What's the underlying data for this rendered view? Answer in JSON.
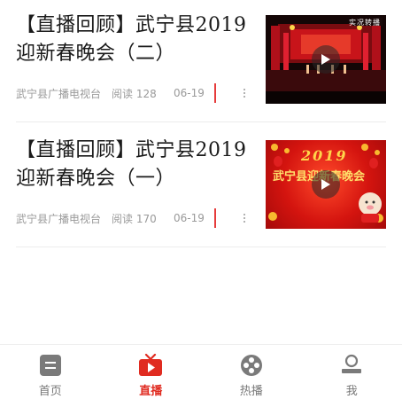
{
  "articles": [
    {
      "title": "【直播回顾】武宁县2019迎新春晚会（二）",
      "source": "武宁县广播电视台",
      "reads": "阅读 128",
      "date": "06-19",
      "thumb_caption": "实况转播"
    },
    {
      "title": "【直播回顾】武宁县2019迎新春晚会（一）",
      "source": "武宁县广播电视台",
      "reads": "阅读 170",
      "date": "06-19",
      "thumb_caption": "2019",
      "thumb_subcaption": "武宁县迎新春晚会"
    }
  ],
  "tabbar": {
    "items": [
      {
        "label": "首页",
        "icon": "home-icon"
      },
      {
        "label": "直播",
        "icon": "tv-icon"
      },
      {
        "label": "热播",
        "icon": "film-reel-icon"
      },
      {
        "label": "我",
        "icon": "user-icon"
      }
    ],
    "active_index": 1
  },
  "colors": {
    "accent": "#e02b20",
    "meta_text": "#9a9a9a",
    "tab_inactive": "#777777"
  }
}
